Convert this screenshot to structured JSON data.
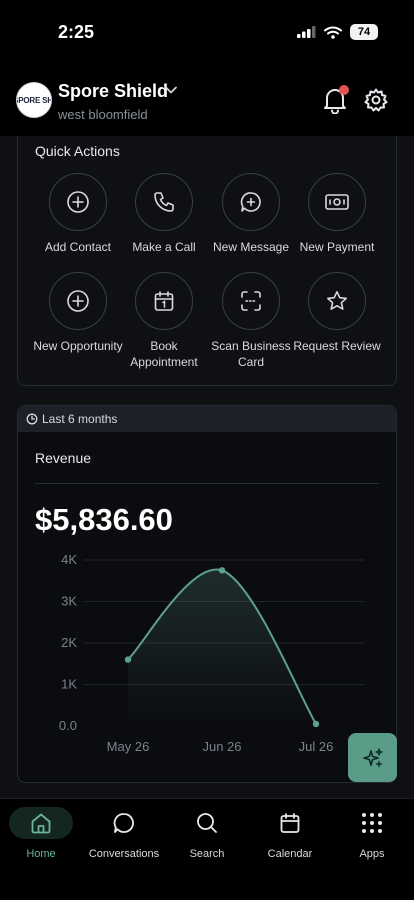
{
  "status_bar": {
    "time": "2:25",
    "battery": "74"
  },
  "header": {
    "account_name": "Spore Shield",
    "location": "west bloomfield",
    "avatar_text": "SPORE SHI"
  },
  "quick_actions": {
    "title": "Quick Actions",
    "items": [
      {
        "label": "Add Contact",
        "icon": "plus-circle-icon"
      },
      {
        "label": "Make a Call",
        "icon": "phone-icon"
      },
      {
        "label": "New Message",
        "icon": "message-plus-icon"
      },
      {
        "label": "New Payment",
        "icon": "banknote-icon"
      },
      {
        "label": "New Opportunity",
        "icon": "plus-circle-icon"
      },
      {
        "label": "Book Appointment",
        "icon": "calendar-icon"
      },
      {
        "label": "Scan Business Card",
        "icon": "scan-icon"
      },
      {
        "label": "Request Review",
        "icon": "star-icon"
      }
    ]
  },
  "revenue": {
    "period": "Last 6 months",
    "title": "Revenue",
    "amount": "$5,836.60"
  },
  "chart_data": {
    "type": "area",
    "categories": [
      "May 26",
      "Jun 26",
      "Jul 26"
    ],
    "series": [
      {
        "values": [
          1600,
          3750,
          50
        ]
      }
    ],
    "ylim": [
      0,
      4000
    ],
    "yticks": [
      "4K",
      "3K",
      "2K",
      "1K",
      "0.0"
    ],
    "grid": true,
    "line_color": "#5fa08c"
  },
  "bottom_nav": {
    "items": [
      {
        "label": "Home",
        "icon": "home-icon",
        "active": true
      },
      {
        "label": "Conversations",
        "icon": "chat-bubble-icon",
        "active": false
      },
      {
        "label": "Search",
        "icon": "search-icon",
        "active": false
      },
      {
        "label": "Calendar",
        "icon": "calendar-icon",
        "active": false
      },
      {
        "label": "Apps",
        "icon": "grid-dots-icon",
        "active": false
      }
    ]
  },
  "colors": {
    "accent": "#6db39b",
    "fab": "#5b9c89",
    "notification": "#e25555"
  }
}
